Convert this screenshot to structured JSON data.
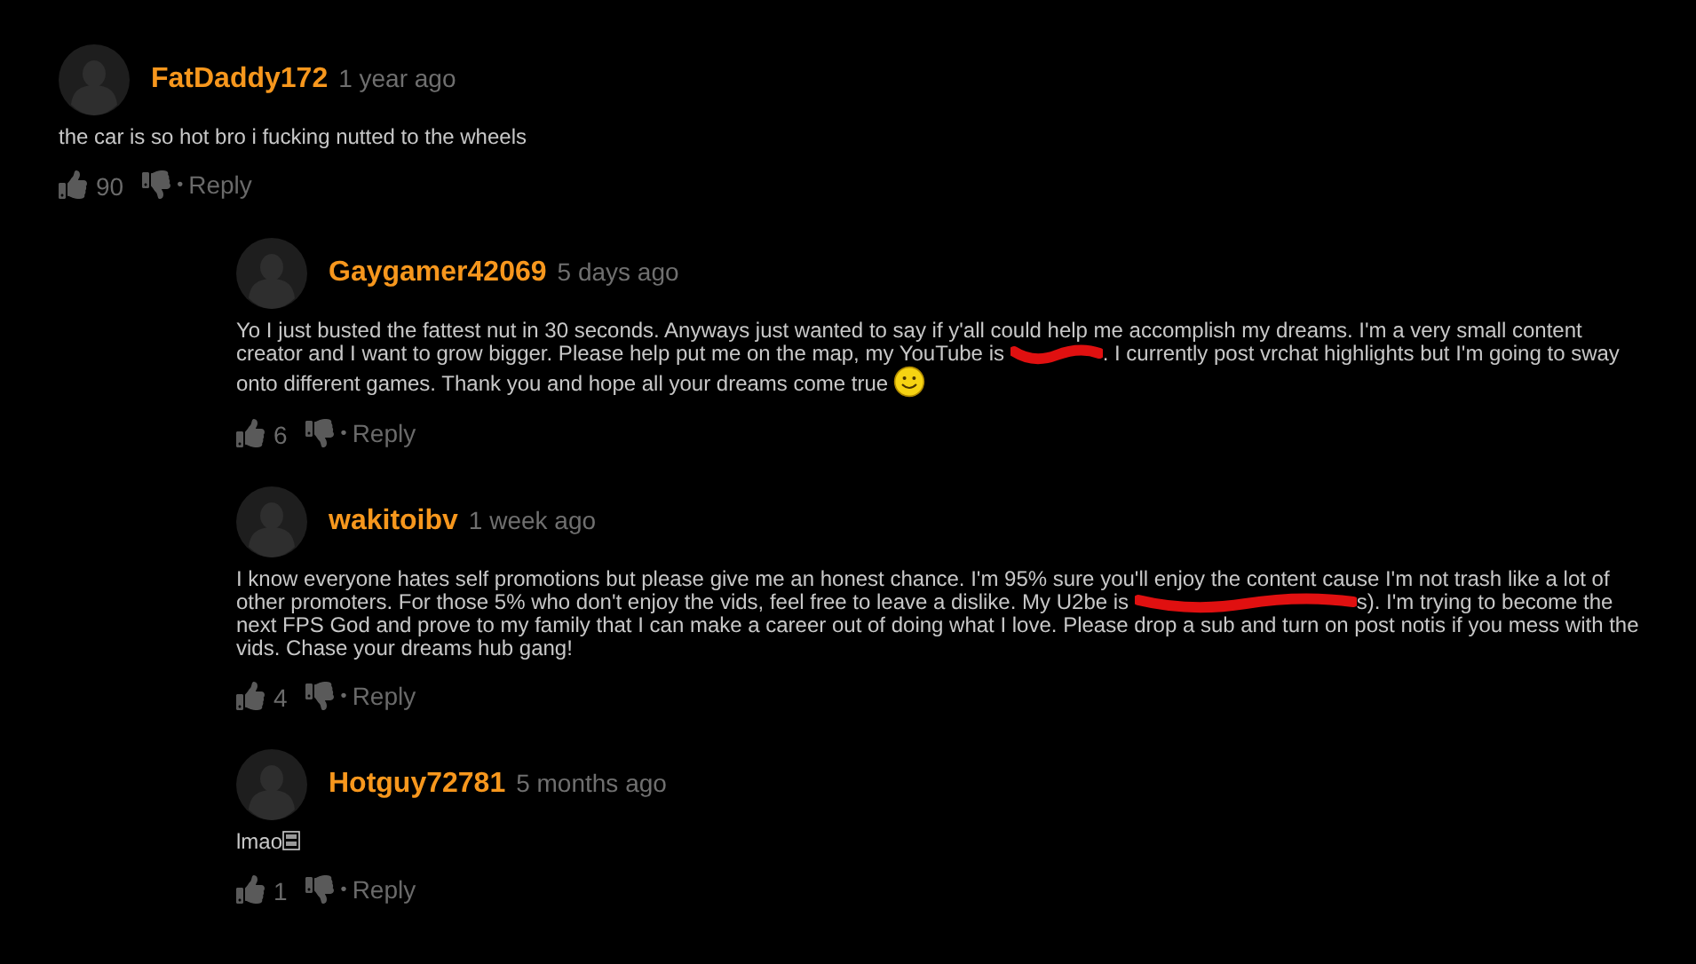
{
  "comments": [
    {
      "author": "FatDaddy172",
      "time": "1 year ago",
      "body": [
        {
          "kind": "text",
          "text": "the car is so hot bro i fucking nutted to the wheels"
        }
      ],
      "likes": "90",
      "separator": "•",
      "reply": "Reply",
      "children": [
        {
          "author": "Gaygamer42069",
          "time": "5 days ago",
          "body": [
            {
              "kind": "text",
              "text": "Yo I just busted the fattest nut in 30 seconds. Anyways just wanted to say if y'all could help me accomplish my dreams. I'm a very small content creator and I want to grow bigger. Please help put me on the map, my YouTube is "
            },
            {
              "kind": "redacted"
            },
            {
              "kind": "text",
              "text": ". I currently post vrchat highlights but I'm going to sway onto different games. Thank you and hope all your dreams come true "
            },
            {
              "kind": "smiley"
            }
          ],
          "likes": "6",
          "separator": "•",
          "reply": "Reply"
        },
        {
          "author": "wakitoibv",
          "time": "1 week ago",
          "body": [
            {
              "kind": "text",
              "text": "I know everyone hates self promotions but please give me an honest chance. I'm 95% sure you'll enjoy the content cause I'm not trash like a lot of other promoters. For those 5% who don't enjoy the vids, feel free to leave a dislike. My U2be is "
            },
            {
              "kind": "redacted_long"
            },
            {
              "kind": "text",
              "text": "s). I'm trying to become the next FPS God and prove to my family that I can make a career out of doing what I love. Please drop a sub and turn on post notis if you mess with the vids. Chase your dreams hub gang!"
            }
          ],
          "likes": "4",
          "separator": "•",
          "reply": "Reply"
        },
        {
          "author": "Hotguy72781",
          "time": "5 months ago",
          "body": [
            {
              "kind": "text",
              "text": "lmao"
            },
            {
              "kind": "missing_glyph"
            }
          ],
          "likes": "1",
          "separator": "•",
          "reply": "Reply"
        }
      ]
    }
  ]
}
